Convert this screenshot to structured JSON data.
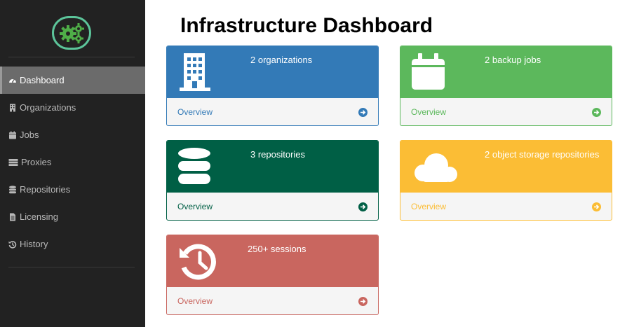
{
  "sidebar": {
    "items": [
      {
        "label": "Dashboard",
        "icon": "tachometer-icon",
        "active": true
      },
      {
        "label": "Organizations",
        "icon": "building-icon"
      },
      {
        "label": "Jobs",
        "icon": "calendar-icon"
      },
      {
        "label": "Proxies",
        "icon": "server-icon"
      },
      {
        "label": "Repositories",
        "icon": "database-icon"
      },
      {
        "label": "Licensing",
        "icon": "file-icon"
      },
      {
        "label": "History",
        "icon": "history-icon"
      }
    ]
  },
  "page": {
    "title": "Infrastructure Dashboard"
  },
  "cards": [
    {
      "text": "2 organizations",
      "link": "Overview",
      "icon": "building-icon",
      "color": "#337ab7"
    },
    {
      "text": "2 backup jobs",
      "link": "Overview",
      "icon": "calendar-icon",
      "color": "#5cb85c"
    },
    {
      "text": "3 repositories",
      "link": "Overview",
      "icon": "database-icon",
      "color": "#005f45"
    },
    {
      "text": "2 object storage repositories",
      "link": "Overview",
      "icon": "cloud-icon",
      "color": "#fbbd35"
    },
    {
      "text": "250+ sessions",
      "link": "Overview",
      "icon": "history-icon",
      "color": "#c9665f"
    }
  ],
  "colors": {
    "sidebar_bg": "#222222",
    "logo_accent": "#5cc49a"
  }
}
